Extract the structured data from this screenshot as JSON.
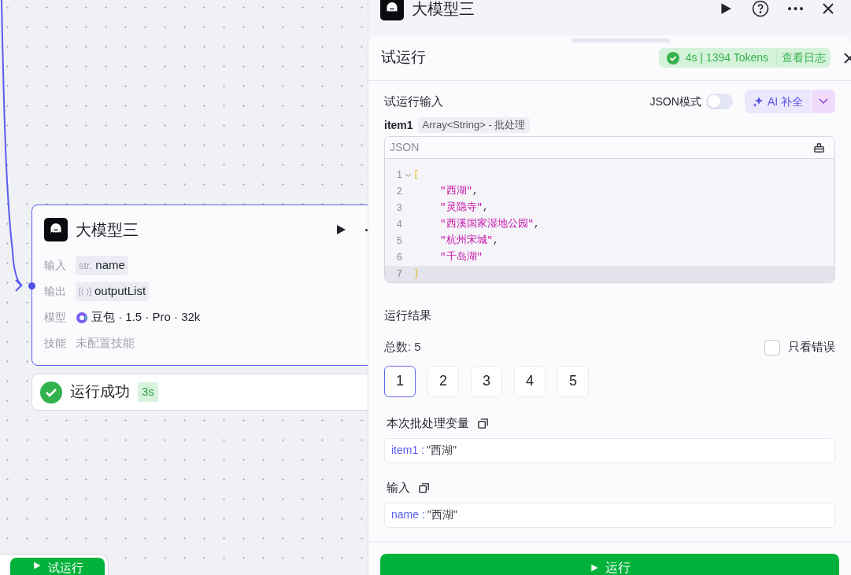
{
  "node": {
    "title": "大模型三",
    "rows": [
      {
        "label": "输入",
        "kind": "string",
        "type_mark": "str.",
        "value": "name"
      },
      {
        "label": "输出",
        "kind": "list",
        "value": "outputList"
      },
      {
        "label": "模型",
        "kind": "model",
        "value": "豆包 · 1.5 · Pro · 32k"
      },
      {
        "label": "技能",
        "kind": "empty",
        "value": "未配置技能"
      }
    ],
    "status": {
      "label": "运行成功",
      "time": "3s"
    }
  },
  "trial_button": "试运行",
  "panel": {
    "title": "大模型三"
  },
  "sheet": {
    "title": "试运行",
    "result_badge": "4s | 1394 Tokens",
    "log_link": "查看日志",
    "input_title": "试运行输入",
    "json_mode": {
      "label": "JSON模式",
      "on": false
    },
    "ai_button": "AI 补全",
    "field": {
      "name": "item1",
      "type": "Array<String> - 批处理"
    },
    "editor": {
      "label": "JSON",
      "lines": [
        {
          "number": "1",
          "kind": "bracket",
          "value": "[",
          "active": false
        },
        {
          "number": "2",
          "kind": "string",
          "value": "\"西湖\"",
          "punct": ",",
          "active": false
        },
        {
          "number": "3",
          "kind": "string",
          "value": "\"灵隐寺\"",
          "punct": ",",
          "active": false
        },
        {
          "number": "4",
          "kind": "string",
          "value": "\"西溪国家湿地公园\"",
          "punct": ",",
          "active": false
        },
        {
          "number": "5",
          "kind": "string",
          "value": "\"杭州宋城\"",
          "punct": ",",
          "active": false
        },
        {
          "number": "6",
          "kind": "string",
          "value": "\"千岛湖\"",
          "active": false
        },
        {
          "number": "7",
          "kind": "bracket",
          "value": "]",
          "active": true
        }
      ]
    },
    "result_title": "运行结果",
    "total": "总数: 5",
    "only_errors": {
      "label": "只看错误",
      "checked": false
    },
    "pages": [
      {
        "label": "1",
        "selected": true
      },
      {
        "label": "2",
        "selected": false
      },
      {
        "label": "3",
        "selected": false
      },
      {
        "label": "4",
        "selected": false
      },
      {
        "label": "5",
        "selected": false
      }
    ],
    "sections": [
      {
        "title": "本次批处理变量",
        "key": "item1 :",
        "value": "\"西湖\""
      },
      {
        "title": "输入",
        "key": "name :",
        "value": "\"西湖\""
      }
    ],
    "run_button": "运行"
  }
}
